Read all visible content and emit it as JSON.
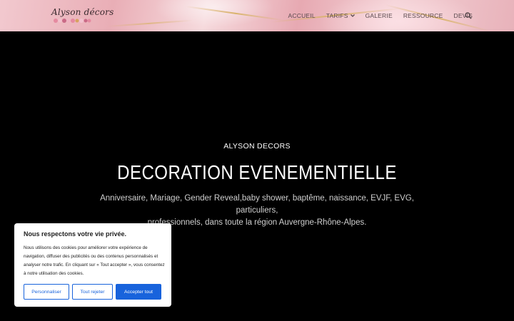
{
  "header": {
    "logo_text": "Alyson décors",
    "nav": [
      {
        "label": "ACCUEIL"
      },
      {
        "label": "TARIFS"
      },
      {
        "label": "GALERIE"
      },
      {
        "label": "RESSOURCE"
      },
      {
        "label": "DEVIS"
      }
    ],
    "search_icon": "search-icon"
  },
  "hero": {
    "brand": "ALYSON DECORS",
    "title": "DECORATION EVENEMENTIELLE",
    "subtitle_line1": "Anniversaire, Mariage, Gender Reveal,baby shower, baptême, naissance, EVJF, EVG, particuliers,",
    "subtitle_line2": "professionnels, dans toute la région Auvergne-Rhône-Alpes."
  },
  "cookie_banner": {
    "title": "Nous respectons votre vie privée.",
    "text": "Nous utilisons des cookies pour améliorer votre expérience de navigation, diffuser des publicités ou des contenus personnalisés et analyser notre trafic. En cliquant sur « Tout accepter », vous consentez à notre utilisation des cookies.",
    "customize_label": "Personnaliser",
    "reject_label": "Tout rejeter",
    "accept_label": "Accepter tout"
  },
  "colors": {
    "accent": "#1863dc",
    "header_pink": "#e9aeb6",
    "background": "#000000"
  }
}
